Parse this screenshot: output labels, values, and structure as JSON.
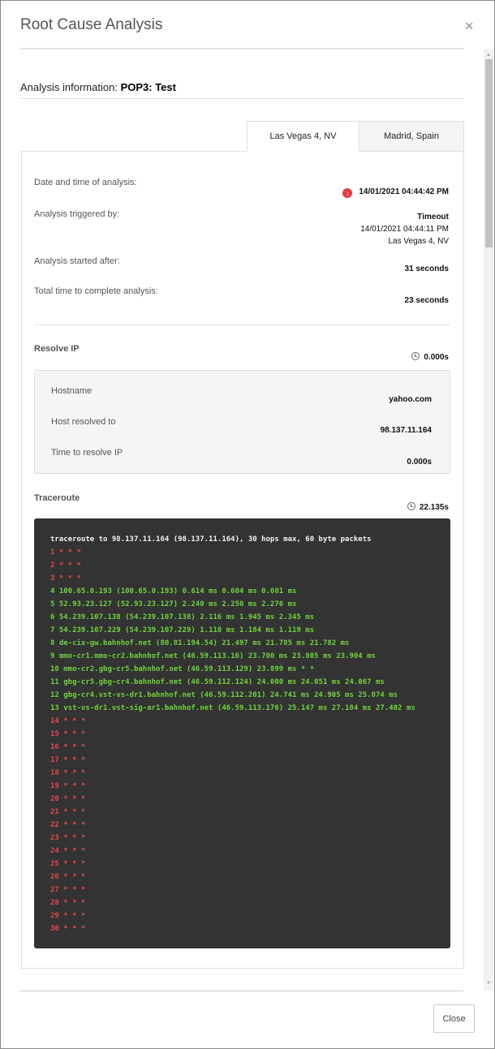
{
  "title": "Root Cause Analysis",
  "info_label": "Analysis information:",
  "info_value": "POP3: Test",
  "tabs": [
    "Las Vegas 4, NV",
    "Madrid, Spain"
  ],
  "details": [
    {
      "label": "Date and time of analysis:",
      "value": "14/01/2021 04:44:42 PM"
    },
    {
      "label": "Analysis triggered by:",
      "value": "Timeout",
      "sub1": "14/01/2021 04:44:11 PM",
      "sub2": "Las Vegas 4, NV"
    },
    {
      "label": "Analysis started after:",
      "value": "31 seconds"
    },
    {
      "label": "Total time to complete analysis:",
      "value": "23 seconds"
    }
  ],
  "resolve": {
    "title": "Resolve IP",
    "time": "0.000s",
    "rows": [
      {
        "label": "Hostname",
        "value": "yahoo.com"
      },
      {
        "label": "Host resolved to",
        "value": "98.137.11.164"
      },
      {
        "label": "Time to resolve IP",
        "value": "0.000s"
      }
    ]
  },
  "traceroute": {
    "title": "Traceroute",
    "time": "22.135s",
    "header": "traceroute to 98.137.11.164 (98.137.11.164), 30 hops max, 60 byte packets",
    "lines": [
      {
        "t": "1 * * *",
        "ok": false
      },
      {
        "t": "2 * * *",
        "ok": false
      },
      {
        "t": "3 * * *",
        "ok": false
      },
      {
        "t": "4 100.65.0.193 (100.65.0.193) 0.614 ms 0.604 ms 0.601 ms",
        "ok": true
      },
      {
        "t": "5 52.93.23.127 (52.93.23.127) 2.240 ms 2.250 ms 2.276 ms",
        "ok": true
      },
      {
        "t": "6 54.239.107.138 (54.239.107.138) 2.116 ms 1.945 ms 2.345 ms",
        "ok": true
      },
      {
        "t": "7 54.239.107.229 (54.239.107.229) 1.110 ms 1.184 ms 1.119 ms",
        "ok": true
      },
      {
        "t": "8 de-cix-gw.bahnhof.net (80.81.194.54) 21.497 ms 21.785 ms 21.782 ms",
        "ok": true
      },
      {
        "t": "9 mmo-cr1.mmo-cr2.bahnhof.net (46.59.113.16) 23.700 ms 23.805 ms 23.904 ms",
        "ok": true
      },
      {
        "t": "10 mmo-cr2.gbg-cr5.bahnhof.net (46.59.113.129) 23.899 ms * *",
        "ok": true
      },
      {
        "t": "11 gbg-cr5.gbg-cr4.bahnhof.net (46.59.112.124) 24.000 ms 24.051 ms 24.067 ms",
        "ok": true
      },
      {
        "t": "12 gbg-cr4.vst-vs-dr1.bahnhof.net (46.59.112.201) 24.741 ms 24.905 ms 25.074 ms",
        "ok": true
      },
      {
        "t": "13 vst-vs-dr1.vst-sig-ar1.bahnhof.net (46.59.113.176) 25.147 ms 27.184 ms 27.402 ms",
        "ok": true
      },
      {
        "t": "14 * * *",
        "ok": false
      },
      {
        "t": "15 * * *",
        "ok": false
      },
      {
        "t": "16 * * *",
        "ok": false
      },
      {
        "t": "17 * * *",
        "ok": false
      },
      {
        "t": "18 * * *",
        "ok": false
      },
      {
        "t": "19 * * *",
        "ok": false
      },
      {
        "t": "20 * * *",
        "ok": false
      },
      {
        "t": "21 * * *",
        "ok": false
      },
      {
        "t": "22 * * *",
        "ok": false
      },
      {
        "t": "23 * * *",
        "ok": false
      },
      {
        "t": "24 * * *",
        "ok": false
      },
      {
        "t": "25 * * *",
        "ok": false
      },
      {
        "t": "26 * * *",
        "ok": false
      },
      {
        "t": "27 * * *",
        "ok": false
      },
      {
        "t": "28 * * *",
        "ok": false
      },
      {
        "t": "29 * * *",
        "ok": false
      },
      {
        "t": "30 * * *",
        "ok": false
      }
    ]
  },
  "close_label": "Close",
  "close_icon": "×"
}
